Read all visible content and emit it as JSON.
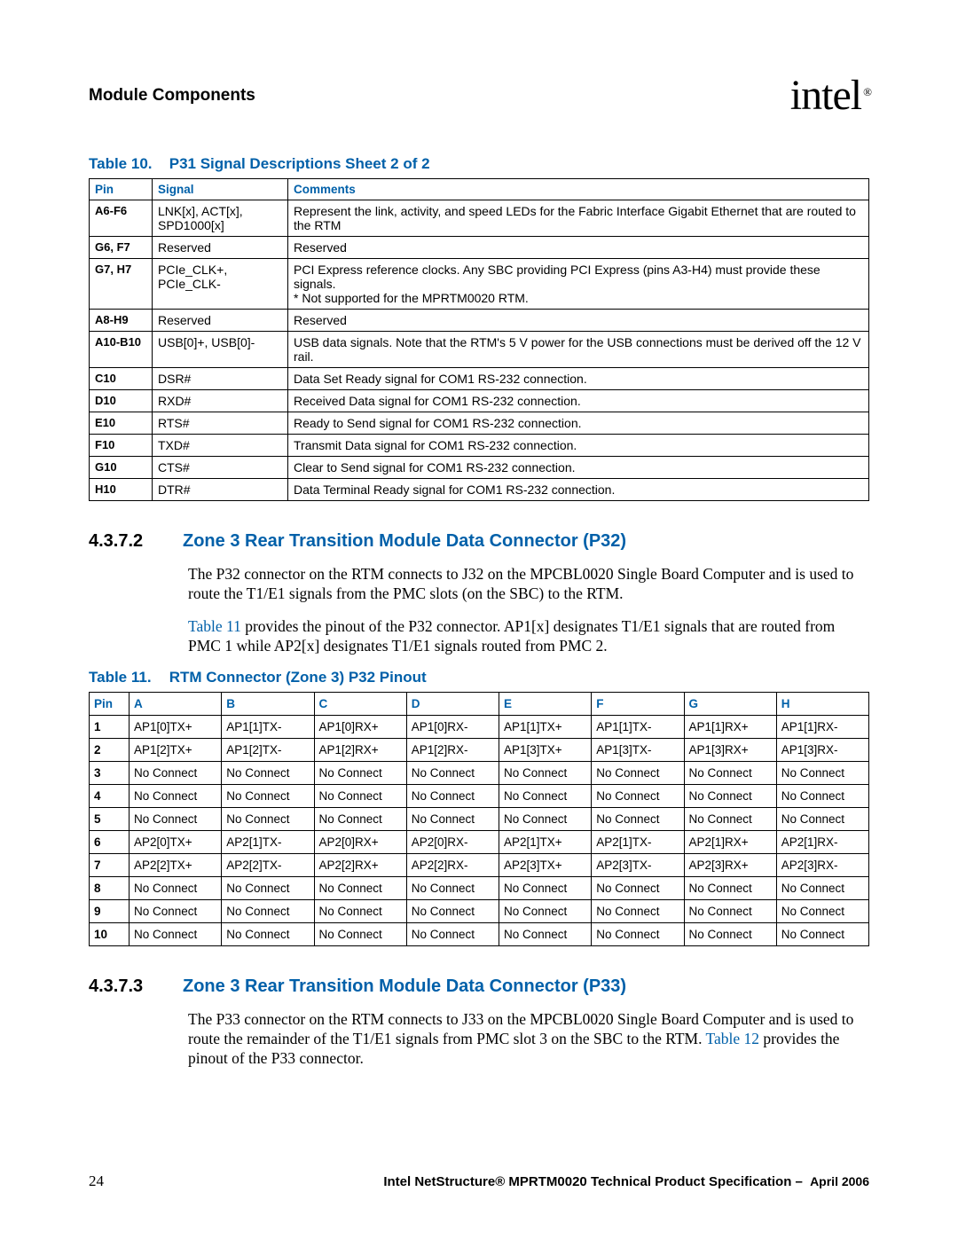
{
  "header": {
    "title": "Module Components",
    "logo_text": "intel",
    "logo_reg": "®"
  },
  "table10": {
    "caption_label": "Table 10.",
    "caption_title": "P31 Signal Descriptions  Sheet 2 of 2",
    "headers": {
      "pin": "Pin",
      "signal": "Signal",
      "comments": "Comments"
    },
    "rows": [
      {
        "pin": "A6-F6",
        "signal": "LNK[x], ACT[x], SPD1000[x]",
        "comments": "Represent the link, activity, and speed LEDs for the Fabric Interface Gigabit Ethernet that are routed to the RTM"
      },
      {
        "pin": "G6, F7",
        "signal": "Reserved",
        "comments": "Reserved"
      },
      {
        "pin": "G7, H7",
        "signal": "PCIe_CLK+, PCIe_CLK-",
        "comments": "PCI Express reference clocks. Any SBC providing PCI Express (pins A3-H4) must provide these signals.\n* Not supported for the MPRTM0020 RTM."
      },
      {
        "pin": "A8-H9",
        "signal": "Reserved",
        "comments": "Reserved"
      },
      {
        "pin": "A10-B10",
        "signal": "USB[0]+, USB[0]-",
        "comments": "USB data signals. Note that the RTM's 5 V power for the USB connections must be derived off the 12 V rail."
      },
      {
        "pin": "C10",
        "signal": "DSR#",
        "comments": "Data Set Ready signal for COM1 RS-232 connection."
      },
      {
        "pin": "D10",
        "signal": "RXD#",
        "comments": "Received Data signal for COM1 RS-232 connection."
      },
      {
        "pin": "E10",
        "signal": "RTS#",
        "comments": "Ready to Send signal for COM1 RS-232 connection."
      },
      {
        "pin": "F10",
        "signal": "TXD#",
        "comments": "Transmit Data signal for COM1 RS-232 connection."
      },
      {
        "pin": "G10",
        "signal": "CTS#",
        "comments": "Clear to Send signal for COM1 RS-232 connection."
      },
      {
        "pin": "H10",
        "signal": "DTR#",
        "comments": "Data Terminal Ready signal for COM1 RS-232 connection."
      }
    ]
  },
  "section_4_3_7_2": {
    "num": "4.3.7.2",
    "title": "Zone 3 Rear Transition Module Data Connector (P32)",
    "para1": "The P32 connector on the RTM connects to J32 on the MPCBL0020 Single Board Computer and is used to route the T1/E1 signals from the PMC slots (on the SBC) to the RTM.",
    "para2_link": "Table 11",
    "para2_rest": " provides the pinout of the P32 connector. AP1[x] designates T1/E1 signals that are routed from PMC 1 while AP2[x] designates T1/E1 signals routed from PMC 2."
  },
  "table11": {
    "caption_label": "Table 11.",
    "caption_title": "RTM Connector (Zone 3) P32 Pinout",
    "headers": [
      "Pin",
      "A",
      "B",
      "C",
      "D",
      "E",
      "F",
      "G",
      "H"
    ],
    "rows": [
      [
        "1",
        "AP1[0]TX+",
        "AP1[1]TX-",
        "AP1[0]RX+",
        "AP1[0]RX-",
        "AP1[1]TX+",
        "AP1[1]TX-",
        "AP1[1]RX+",
        "AP1[1]RX-"
      ],
      [
        "2",
        "AP1[2]TX+",
        "AP1[2]TX-",
        "AP1[2]RX+",
        "AP1[2]RX-",
        "AP1[3]TX+",
        "AP1[3]TX-",
        "AP1[3]RX+",
        "AP1[3]RX-"
      ],
      [
        "3",
        "No Connect",
        "No Connect",
        "No Connect",
        "No Connect",
        "No Connect",
        "No Connect",
        "No Connect",
        "No Connect"
      ],
      [
        "4",
        "No Connect",
        "No Connect",
        "No Connect",
        "No Connect",
        "No Connect",
        "No Connect",
        "No Connect",
        "No Connect"
      ],
      [
        "5",
        "No Connect",
        "No Connect",
        "No Connect",
        "No Connect",
        "No Connect",
        "No Connect",
        "No Connect",
        "No Connect"
      ],
      [
        "6",
        "AP2[0]TX+",
        "AP2[1]TX-",
        "AP2[0]RX+",
        "AP2[0]RX-",
        "AP2[1]TX+",
        "AP2[1]TX-",
        "AP2[1]RX+",
        "AP2[1]RX-"
      ],
      [
        "7",
        "AP2[2]TX+",
        "AP2[2]TX-",
        "AP2[2]RX+",
        "AP2[2]RX-",
        "AP2[3]TX+",
        "AP2[3]TX-",
        "AP2[3]RX+",
        "AP2[3]RX-"
      ],
      [
        "8",
        "No Connect",
        "No Connect",
        "No Connect",
        "No Connect",
        "No Connect",
        "No Connect",
        "No Connect",
        "No Connect"
      ],
      [
        "9",
        "No Connect",
        "No Connect",
        "No Connect",
        "No Connect",
        "No Connect",
        "No Connect",
        "No Connect",
        "No Connect"
      ],
      [
        "10",
        "No Connect",
        "No Connect",
        "No Connect",
        "No Connect",
        "No Connect",
        "No Connect",
        "No Connect",
        "No Connect"
      ]
    ]
  },
  "section_4_3_7_3": {
    "num": "4.3.7.3",
    "title": "Zone 3 Rear Transition Module Data Connector (P33)",
    "para1_a": "The P33 connector on the RTM connects to J33 on the MPCBL0020 Single Board Computer and is used to route the remainder of the T1/E1 signals from PMC slot 3 on the SBC to the RTM. ",
    "para1_link": "Table 12",
    "para1_b": " provides the pinout of the P33 connector."
  },
  "footer": {
    "page": "24",
    "title": "Intel NetStructure® MPRTM0020 Technical Product Specification – ",
    "date": "April 2006"
  }
}
